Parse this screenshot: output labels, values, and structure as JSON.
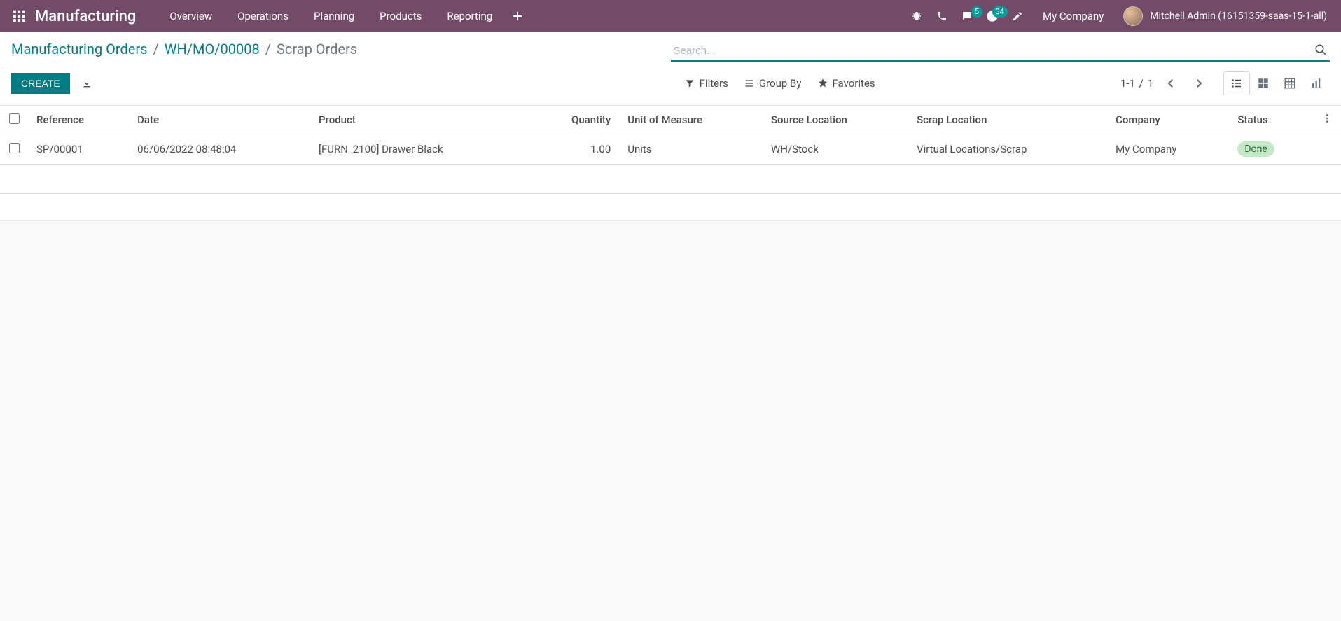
{
  "header": {
    "brand": "Manufacturing",
    "menu": [
      "Overview",
      "Operations",
      "Planning",
      "Products",
      "Reporting"
    ],
    "badges": {
      "messages": "5",
      "activities": "34"
    },
    "company": "My Company",
    "user": "Mitchell Admin (16151359-saas-15-1-all)"
  },
  "breadcrumb": {
    "items": [
      {
        "label": "Manufacturing Orders",
        "link": true
      },
      {
        "label": "WH/MO/00008",
        "link": true
      },
      {
        "label": "Scrap Orders",
        "link": false
      }
    ],
    "sep": "/"
  },
  "toolbar": {
    "create_label": "CREATE",
    "filters_label": "Filters",
    "groupby_label": "Group By",
    "favorites_label": "Favorites"
  },
  "search": {
    "placeholder": "Search..."
  },
  "pager": {
    "range": "1-1",
    "sep": "/",
    "total": "1"
  },
  "columns": {
    "reference": "Reference",
    "date": "Date",
    "product": "Product",
    "quantity": "Quantity",
    "uom": "Unit of Measure",
    "src_loc": "Source Location",
    "scrap_loc": "Scrap Location",
    "company": "Company",
    "status": "Status"
  },
  "rows": [
    {
      "reference": "SP/00001",
      "date": "06/06/2022 08:48:04",
      "product": "[FURN_2100] Drawer Black",
      "quantity": "1.00",
      "uom": "Units",
      "src_loc": "WH/Stock",
      "scrap_loc": "Virtual Locations/Scrap",
      "company": "My Company",
      "status": "Done"
    }
  ]
}
